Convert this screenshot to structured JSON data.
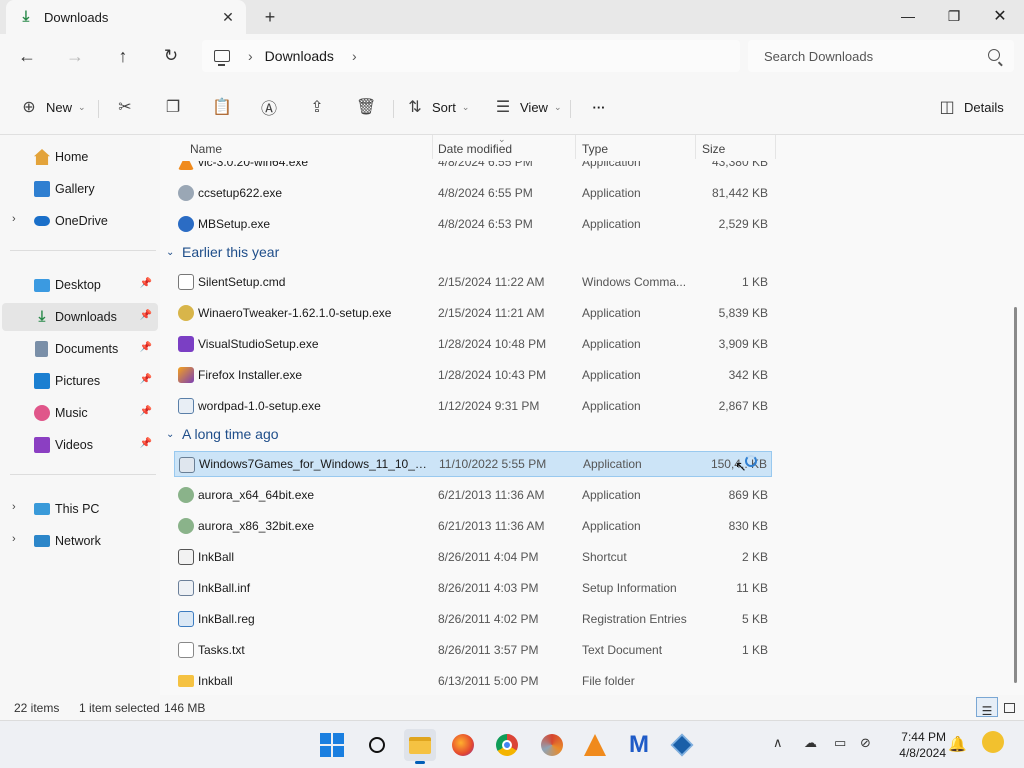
{
  "tab": {
    "title": "Downloads",
    "close": "✕",
    "new_tab": "+"
  },
  "window_controls": {
    "minimize": "—",
    "maximize": "❐",
    "close": "✕"
  },
  "address": {
    "path": [
      "Downloads"
    ],
    "search_placeholder": "Search Downloads"
  },
  "commands": {
    "new": "New",
    "sort": "Sort",
    "view": "View",
    "more": "···",
    "details": "Details"
  },
  "nav": {
    "home": "Home",
    "gallery": "Gallery",
    "onedrive": "OneDrive",
    "desktop": "Desktop",
    "downloads": "Downloads",
    "documents": "Documents",
    "pictures": "Pictures",
    "music": "Music",
    "videos": "Videos",
    "thispc": "This PC",
    "network": "Network"
  },
  "columns": {
    "name": "Name",
    "date": "Date modified",
    "type": "Type",
    "size": "Size"
  },
  "groups": {
    "earlier": "Earlier this year",
    "longago": "A long time ago"
  },
  "files": [
    {
      "name": "vlc-3.0.20-win64.exe",
      "date": "4/8/2024 6:55 PM",
      "type": "Application",
      "size": "43,380 KB"
    },
    {
      "name": "ccsetup622.exe",
      "date": "4/8/2024 6:55 PM",
      "type": "Application",
      "size": "81,442 KB"
    },
    {
      "name": "MBSetup.exe",
      "date": "4/8/2024 6:53 PM",
      "type": "Application",
      "size": "2,529 KB"
    },
    {
      "name": "SilentSetup.cmd",
      "date": "2/15/2024 11:22 AM",
      "type": "Windows Comma...",
      "size": "1 KB"
    },
    {
      "name": "WinaeroTweaker-1.62.1.0-setup.exe",
      "date": "2/15/2024 11:21 AM",
      "type": "Application",
      "size": "5,839 KB"
    },
    {
      "name": "VisualStudioSetup.exe",
      "date": "1/28/2024 10:48 PM",
      "type": "Application",
      "size": "3,909 KB"
    },
    {
      "name": "Firefox Installer.exe",
      "date": "1/28/2024 10:43 PM",
      "type": "Application",
      "size": "342 KB"
    },
    {
      "name": "wordpad-1.0-setup.exe",
      "date": "1/12/2024 9:31 PM",
      "type": "Application",
      "size": "2,867 KB"
    },
    {
      "name": "Windows7Games_for_Windows_11_10_8....",
      "date": "11/10/2022 5:55 PM",
      "type": "Application",
      "size": "150,4.. KB"
    },
    {
      "name": "aurora_x64_64bit.exe",
      "date": "6/21/2013 11:36 AM",
      "type": "Application",
      "size": "869 KB"
    },
    {
      "name": "aurora_x86_32bit.exe",
      "date": "6/21/2013 11:36 AM",
      "type": "Application",
      "size": "830 KB"
    },
    {
      "name": "InkBall",
      "date": "8/26/2011 4:04 PM",
      "type": "Shortcut",
      "size": "2 KB"
    },
    {
      "name": "InkBall.inf",
      "date": "8/26/2011 4:03 PM",
      "type": "Setup Information",
      "size": "11 KB"
    },
    {
      "name": "InkBall.reg",
      "date": "8/26/2011 4:02 PM",
      "type": "Registration Entries",
      "size": "5 KB"
    },
    {
      "name": "Tasks.txt",
      "date": "8/26/2011 3:57 PM",
      "type": "Text Document",
      "size": "1 KB"
    },
    {
      "name": "Inkball",
      "date": "6/13/2011 5:00 PM",
      "type": "File folder",
      "size": ""
    }
  ],
  "status": {
    "items": "22 items",
    "selected": "1 item selected",
    "size": "146 MB"
  },
  "clock": {
    "time": "7:44 PM",
    "date": "4/8/2024"
  }
}
